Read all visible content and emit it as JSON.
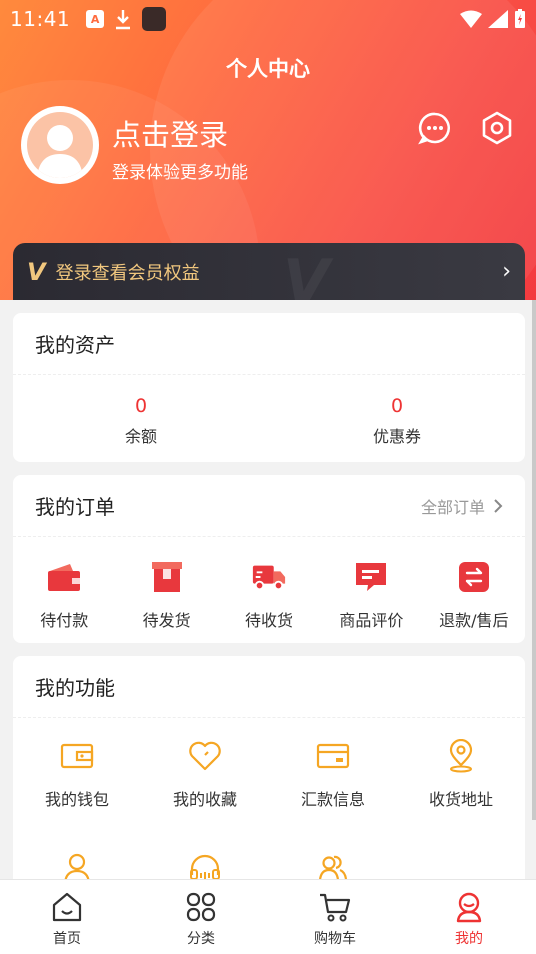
{
  "status_bar": {
    "time": "11:41",
    "a_icon_label": "A"
  },
  "header": {
    "title": "个人中心",
    "login_title": "点击登录",
    "login_subtitle": "登录体验更多功能",
    "message_icon": "chat-dots-icon",
    "settings_icon": "hex-settings-icon"
  },
  "vip_banner": {
    "logo": "V",
    "text": "登录查看会员权益",
    "arrow": "›"
  },
  "assets": {
    "title": "我的资产",
    "items": [
      {
        "value": "0",
        "label": "余额"
      },
      {
        "value": "0",
        "label": "优惠券"
      }
    ]
  },
  "orders": {
    "title": "我的订单",
    "all_label": "全部订单",
    "items": [
      {
        "label": "待付款",
        "icon": "wallet-icon"
      },
      {
        "label": "待发货",
        "icon": "package-icon"
      },
      {
        "label": "待收货",
        "icon": "truck-icon"
      },
      {
        "label": "商品评价",
        "icon": "comment-icon"
      },
      {
        "label": "退款/售后",
        "icon": "refund-icon"
      }
    ]
  },
  "functions": {
    "title": "我的功能",
    "items": [
      {
        "label": "我的钱包",
        "icon": "wallet-outline-icon"
      },
      {
        "label": "我的收藏",
        "icon": "heart-icon"
      },
      {
        "label": "汇款信息",
        "icon": "card-icon"
      },
      {
        "label": "收货地址",
        "icon": "location-icon"
      },
      {
        "label": "",
        "icon": "user-icon"
      },
      {
        "label": "",
        "icon": "headset-icon"
      },
      {
        "label": "",
        "icon": "users-icon"
      }
    ]
  },
  "tabbar": {
    "items": [
      {
        "label": "首页",
        "icon": "home-icon"
      },
      {
        "label": "分类",
        "icon": "grid-icon"
      },
      {
        "label": "购物车",
        "icon": "cart-icon"
      },
      {
        "label": "我的",
        "icon": "profile-icon",
        "active": true
      }
    ]
  },
  "colors": {
    "accent": "#f33a3f",
    "gold": "#f1c77e",
    "icon_orange": "#f5a623"
  }
}
